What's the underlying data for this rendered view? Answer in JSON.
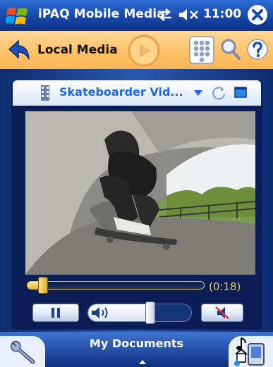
{
  "status_bar": {
    "app_title": "iPAQ Mobile Media",
    "clock": "11:00",
    "icons": [
      "windows-start-icon",
      "connectivity-icon",
      "volume-muted-icon",
      "close-icon"
    ]
  },
  "toolbar": {
    "title": "Local Media",
    "icons": [
      "back-arrow-icon",
      "play-icon",
      "keypad-icon",
      "search-icon",
      "help-icon"
    ]
  },
  "player": {
    "video_title": "Skateboarder Vid...",
    "elapsed_time": "(0:18)",
    "seek_position_fraction": 0.09,
    "volume_fraction": 0.6,
    "icons": [
      "film-icon",
      "dropdown-arrow-icon",
      "repeat-icon",
      "fullscreen-icon",
      "pause-icon",
      "speaker-icon",
      "mute-icon"
    ]
  },
  "bottom_bar": {
    "label": "My Documents",
    "icons": [
      "tools-icon",
      "device-icon"
    ]
  },
  "colors": {
    "title_bar": "#1747a8",
    "toolbar": "#ffc46a",
    "video_title": "#1d68e6",
    "time_label": "#e8c55a"
  }
}
